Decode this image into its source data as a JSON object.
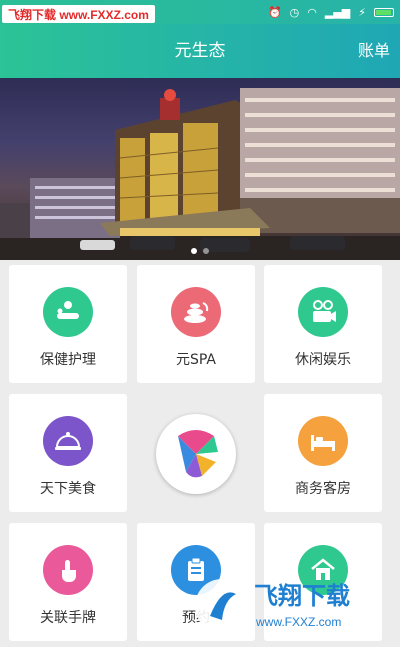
{
  "status": {
    "watermark_text": "飞翔下载 www.FXXZ.com",
    "icons": [
      "alarm-icon",
      "clock-icon",
      "wifi-icon",
      "signal-icon",
      "charging-icon",
      "battery-icon"
    ]
  },
  "header": {
    "title": "元生态",
    "action": "账单"
  },
  "banner": {
    "slide_count": 2,
    "active_slide": 1
  },
  "grid": {
    "items": [
      {
        "label": "保健护理",
        "icon": "massage-icon",
        "color": "#2fc88f"
      },
      {
        "label": "元SPA",
        "icon": "spa-stones-icon",
        "color": "#ec6a76"
      },
      {
        "label": "休闲娱乐",
        "icon": "projector-icon",
        "color": "#2fc88f"
      },
      {
        "label": "天下美食",
        "icon": "food-cloche-icon",
        "color": "#7b55c9"
      },
      {
        "label": "商务客房",
        "icon": "bed-icon",
        "color": "#f5a13d"
      },
      {
        "label": "关联手牌",
        "icon": "hand-tap-icon",
        "color": "#ea5a9a"
      },
      {
        "label": "预约",
        "icon": "booking-clipboard-icon",
        "color": "#2c8fe0"
      },
      {
        "label": "",
        "icon": "house-icon",
        "color": "#2fc88f"
      }
    ],
    "center_logo": "app-logo-icon"
  },
  "watermark_bottom": {
    "text": "飞翔下载",
    "url": "www.FXXZ.com"
  }
}
